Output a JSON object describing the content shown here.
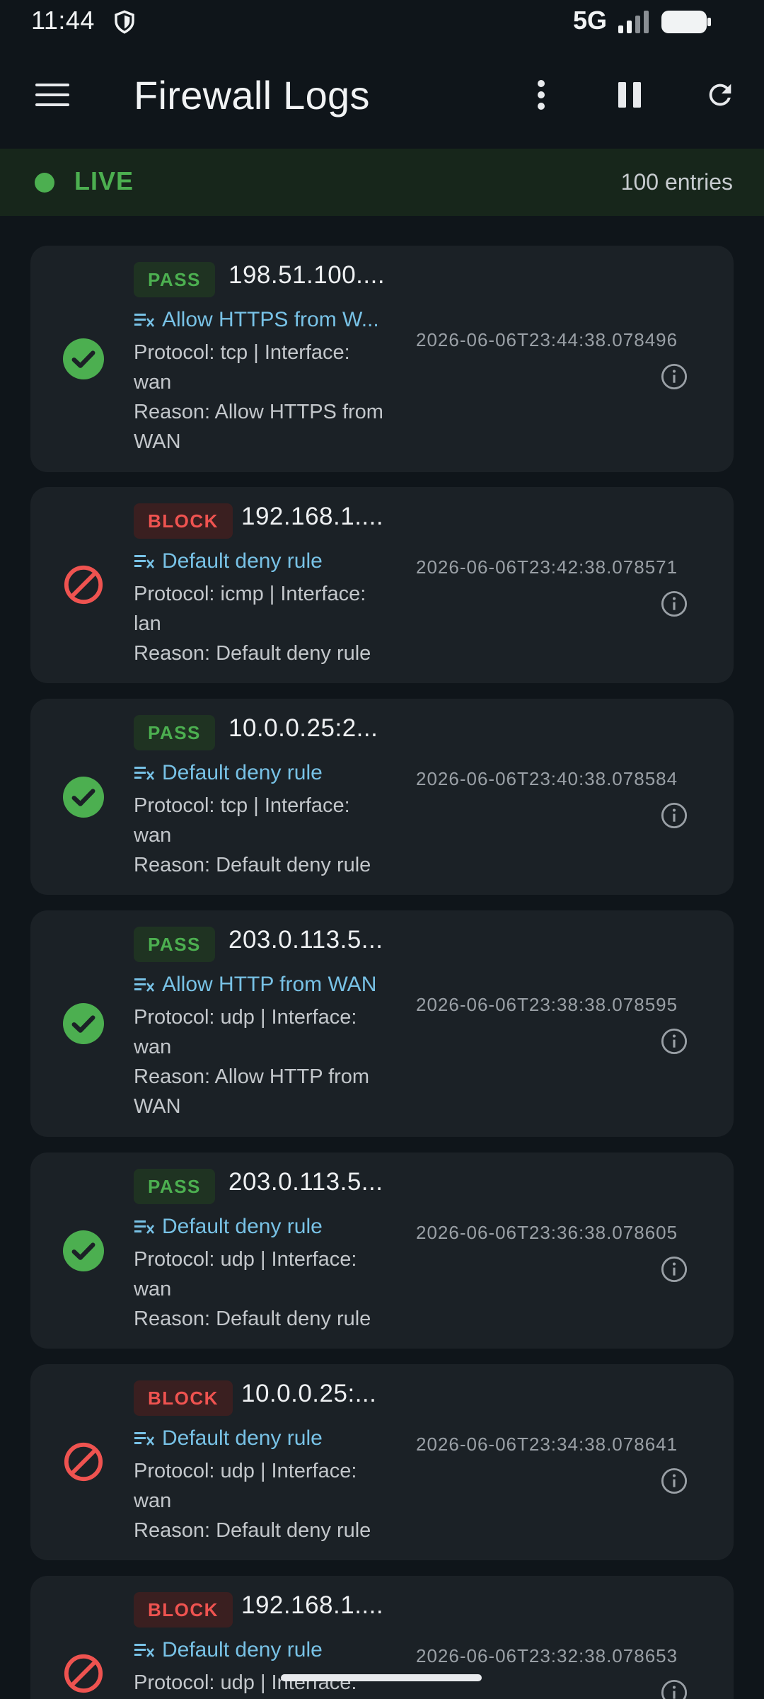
{
  "status_bar": {
    "time": "11:44",
    "network": "5G",
    "icons": [
      "shield-icon",
      "signal-icon",
      "battery-icon"
    ]
  },
  "app_bar": {
    "title": "Firewall Logs",
    "icons": [
      "menu-icon",
      "more-vert-icon",
      "pause-icon",
      "refresh-icon"
    ]
  },
  "live_banner": {
    "status": "LIVE",
    "entries": "100 entries"
  },
  "colors": {
    "pass": "#4caf50",
    "block": "#ef5350",
    "rule_text": "#78c2e6",
    "card_bg": "#1b2126",
    "page_bg": "#0f151a"
  },
  "logs": [
    {
      "action": "PASS",
      "source": "198.51.100....",
      "rule": "Allow HTTPS from W...",
      "protocol": "Protocol: tcp | Interface: wan",
      "reason": "Reason: Allow HTTPS from WAN",
      "timestamp": "2026-06-06T23:44:38.078496"
    },
    {
      "action": "BLOCK",
      "source": "192.168.1....",
      "rule": "Default deny rule",
      "protocol": "Protocol: icmp | Interface: lan",
      "reason": "Reason: Default deny rule",
      "timestamp": "2026-06-06T23:42:38.078571"
    },
    {
      "action": "PASS",
      "source": "10.0.0.25:2...",
      "rule": "Default deny rule",
      "protocol": "Protocol: tcp | Interface: wan",
      "reason": "Reason: Default deny rule",
      "timestamp": "2026-06-06T23:40:38.078584"
    },
    {
      "action": "PASS",
      "source": "203.0.113.5...",
      "rule": "Allow HTTP from WAN",
      "protocol": "Protocol: udp | Interface: wan",
      "reason": "Reason: Allow HTTP from WAN",
      "timestamp": "2026-06-06T23:38:38.078595"
    },
    {
      "action": "PASS",
      "source": "203.0.113.5...",
      "rule": "Default deny rule",
      "protocol": "Protocol: udp | Interface: wan",
      "reason": "Reason: Default deny rule",
      "timestamp": "2026-06-06T23:36:38.078605"
    },
    {
      "action": "BLOCK",
      "source": "10.0.0.25:...",
      "rule": "Default deny rule",
      "protocol": "Protocol: udp | Interface: wan",
      "reason": "Reason: Default deny rule",
      "timestamp": "2026-06-06T23:34:38.078641"
    },
    {
      "action": "BLOCK",
      "source": "192.168.1....",
      "rule": "Default deny rule",
      "protocol": "Protocol: udp | Interface:",
      "reason": "",
      "timestamp": "2026-06-06T23:32:38.078653"
    }
  ]
}
